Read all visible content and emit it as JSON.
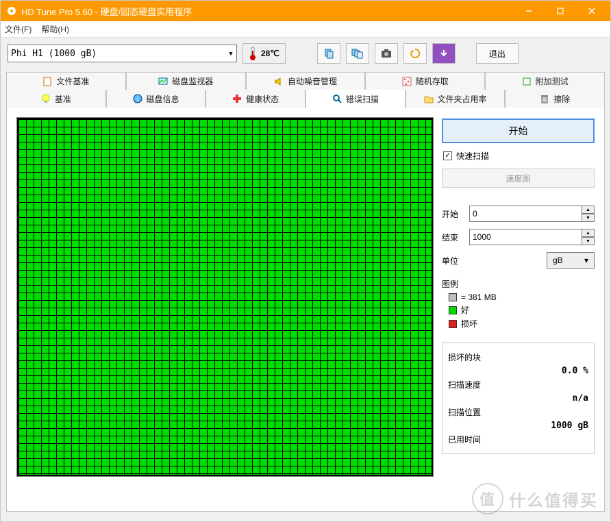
{
  "window": {
    "title": "HD Tune Pro 5.60 - 硬盘/固态硬盘实用程序"
  },
  "menu": {
    "file": "文件(F)",
    "help": "帮助(H)"
  },
  "toolbar": {
    "drive": "Phi   H1 (1000 gB)",
    "temp": "28℃",
    "exit": "退出",
    "icons": {
      "copy": "copy-icon",
      "copyall": "multi-copy-icon",
      "camera": "camera-icon",
      "refresh": "refresh-icon",
      "save": "save-icon"
    }
  },
  "tabs": {
    "row1": [
      "文件基准",
      "磁盘监视器",
      "自动噪音管理",
      "随机存取",
      "附加测试"
    ],
    "row2": [
      "基准",
      "磁盘信息",
      "健康状态",
      "错误扫描",
      "文件夹占用率",
      "擦除"
    ],
    "active": "错误扫描"
  },
  "errorscan": {
    "start": "开始",
    "quick_scan": "快速扫描",
    "quick_checked": true,
    "speed_chart": "速度图",
    "start_label": "开始",
    "start_value": "0",
    "end_label": "结束",
    "end_value": "1000",
    "unit_label": "单位",
    "unit_value": "gB",
    "legend": {
      "title": "图例",
      "block": "= 381 MB",
      "good": "好",
      "bad": "损坏",
      "colors": {
        "block": "#bfbfbf",
        "good": "#00dd00",
        "bad": "#e02020"
      }
    },
    "stats": {
      "damaged_label": "损坏的块",
      "damaged_value": "0.0 %",
      "speed_label": "扫描速度",
      "speed_value": "n/a",
      "pos_label": "扫描位置",
      "pos_value": "1000 gB",
      "time_label": "已用时间"
    }
  },
  "watermark": "什么值得买"
}
